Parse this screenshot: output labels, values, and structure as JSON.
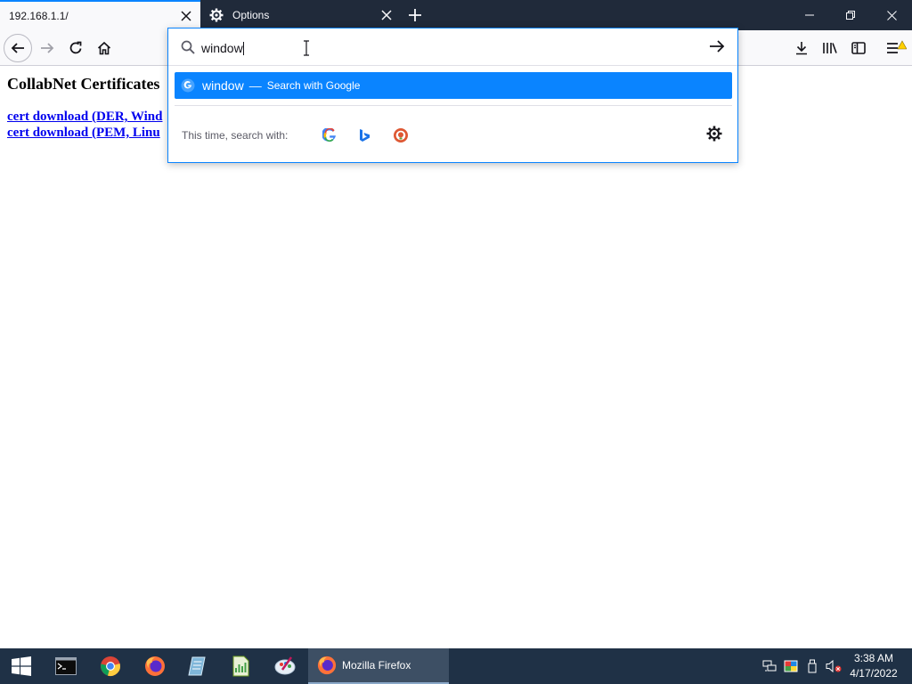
{
  "tabs": [
    {
      "title": "192.168.1.1/",
      "active": true
    },
    {
      "title": "Options",
      "active": false
    }
  ],
  "urlbar": {
    "typed_text": "window",
    "results": [
      {
        "text": "window",
        "separator": "—",
        "action": "Search with Google",
        "icon": "google-icon"
      }
    ],
    "one_off_label": "This time, search with:",
    "engines": [
      "google-icon",
      "bing-icon",
      "duckduckgo-icon"
    ]
  },
  "page": {
    "heading": "CollabNet Certificates",
    "links": [
      "cert download (DER, Wind",
      "cert download (PEM, Linu"
    ]
  },
  "taskbar": {
    "active_window": "Mozilla Firefox",
    "time": "3:38 AM",
    "date": "4/17/2022"
  },
  "colors": {
    "accent": "#0a84ff",
    "tabstrip": "#202a3a",
    "taskbar": "#1f3146",
    "link": "#0000ee"
  }
}
